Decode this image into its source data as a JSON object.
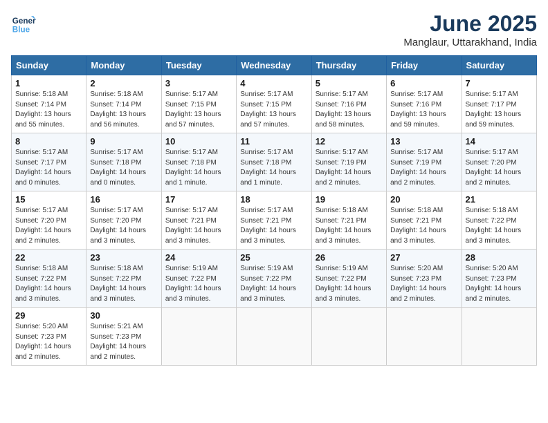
{
  "header": {
    "logo_line1": "General",
    "logo_line2": "Blue",
    "month": "June 2025",
    "location": "Manglaur, Uttarakhand, India"
  },
  "weekdays": [
    "Sunday",
    "Monday",
    "Tuesday",
    "Wednesday",
    "Thursday",
    "Friday",
    "Saturday"
  ],
  "weeks": [
    [
      {
        "day": "1",
        "info": "Sunrise: 5:18 AM\nSunset: 7:14 PM\nDaylight: 13 hours\nand 55 minutes."
      },
      {
        "day": "2",
        "info": "Sunrise: 5:18 AM\nSunset: 7:14 PM\nDaylight: 13 hours\nand 56 minutes."
      },
      {
        "day": "3",
        "info": "Sunrise: 5:17 AM\nSunset: 7:15 PM\nDaylight: 13 hours\nand 57 minutes."
      },
      {
        "day": "4",
        "info": "Sunrise: 5:17 AM\nSunset: 7:15 PM\nDaylight: 13 hours\nand 57 minutes."
      },
      {
        "day": "5",
        "info": "Sunrise: 5:17 AM\nSunset: 7:16 PM\nDaylight: 13 hours\nand 58 minutes."
      },
      {
        "day": "6",
        "info": "Sunrise: 5:17 AM\nSunset: 7:16 PM\nDaylight: 13 hours\nand 59 minutes."
      },
      {
        "day": "7",
        "info": "Sunrise: 5:17 AM\nSunset: 7:17 PM\nDaylight: 13 hours\nand 59 minutes."
      }
    ],
    [
      {
        "day": "8",
        "info": "Sunrise: 5:17 AM\nSunset: 7:17 PM\nDaylight: 14 hours\nand 0 minutes."
      },
      {
        "day": "9",
        "info": "Sunrise: 5:17 AM\nSunset: 7:18 PM\nDaylight: 14 hours\nand 0 minutes."
      },
      {
        "day": "10",
        "info": "Sunrise: 5:17 AM\nSunset: 7:18 PM\nDaylight: 14 hours\nand 1 minute."
      },
      {
        "day": "11",
        "info": "Sunrise: 5:17 AM\nSunset: 7:18 PM\nDaylight: 14 hours\nand 1 minute."
      },
      {
        "day": "12",
        "info": "Sunrise: 5:17 AM\nSunset: 7:19 PM\nDaylight: 14 hours\nand 2 minutes."
      },
      {
        "day": "13",
        "info": "Sunrise: 5:17 AM\nSunset: 7:19 PM\nDaylight: 14 hours\nand 2 minutes."
      },
      {
        "day": "14",
        "info": "Sunrise: 5:17 AM\nSunset: 7:20 PM\nDaylight: 14 hours\nand 2 minutes."
      }
    ],
    [
      {
        "day": "15",
        "info": "Sunrise: 5:17 AM\nSunset: 7:20 PM\nDaylight: 14 hours\nand 2 minutes."
      },
      {
        "day": "16",
        "info": "Sunrise: 5:17 AM\nSunset: 7:20 PM\nDaylight: 14 hours\nand 3 minutes."
      },
      {
        "day": "17",
        "info": "Sunrise: 5:17 AM\nSunset: 7:21 PM\nDaylight: 14 hours\nand 3 minutes."
      },
      {
        "day": "18",
        "info": "Sunrise: 5:17 AM\nSunset: 7:21 PM\nDaylight: 14 hours\nand 3 minutes."
      },
      {
        "day": "19",
        "info": "Sunrise: 5:18 AM\nSunset: 7:21 PM\nDaylight: 14 hours\nand 3 minutes."
      },
      {
        "day": "20",
        "info": "Sunrise: 5:18 AM\nSunset: 7:21 PM\nDaylight: 14 hours\nand 3 minutes."
      },
      {
        "day": "21",
        "info": "Sunrise: 5:18 AM\nSunset: 7:22 PM\nDaylight: 14 hours\nand 3 minutes."
      }
    ],
    [
      {
        "day": "22",
        "info": "Sunrise: 5:18 AM\nSunset: 7:22 PM\nDaylight: 14 hours\nand 3 minutes."
      },
      {
        "day": "23",
        "info": "Sunrise: 5:18 AM\nSunset: 7:22 PM\nDaylight: 14 hours\nand 3 minutes."
      },
      {
        "day": "24",
        "info": "Sunrise: 5:19 AM\nSunset: 7:22 PM\nDaylight: 14 hours\nand 3 minutes."
      },
      {
        "day": "25",
        "info": "Sunrise: 5:19 AM\nSunset: 7:22 PM\nDaylight: 14 hours\nand 3 minutes."
      },
      {
        "day": "26",
        "info": "Sunrise: 5:19 AM\nSunset: 7:22 PM\nDaylight: 14 hours\nand 3 minutes."
      },
      {
        "day": "27",
        "info": "Sunrise: 5:20 AM\nSunset: 7:23 PM\nDaylight: 14 hours\nand 2 minutes."
      },
      {
        "day": "28",
        "info": "Sunrise: 5:20 AM\nSunset: 7:23 PM\nDaylight: 14 hours\nand 2 minutes."
      }
    ],
    [
      {
        "day": "29",
        "info": "Sunrise: 5:20 AM\nSunset: 7:23 PM\nDaylight: 14 hours\nand 2 minutes."
      },
      {
        "day": "30",
        "info": "Sunrise: 5:21 AM\nSunset: 7:23 PM\nDaylight: 14 hours\nand 2 minutes."
      },
      null,
      null,
      null,
      null,
      null
    ]
  ]
}
